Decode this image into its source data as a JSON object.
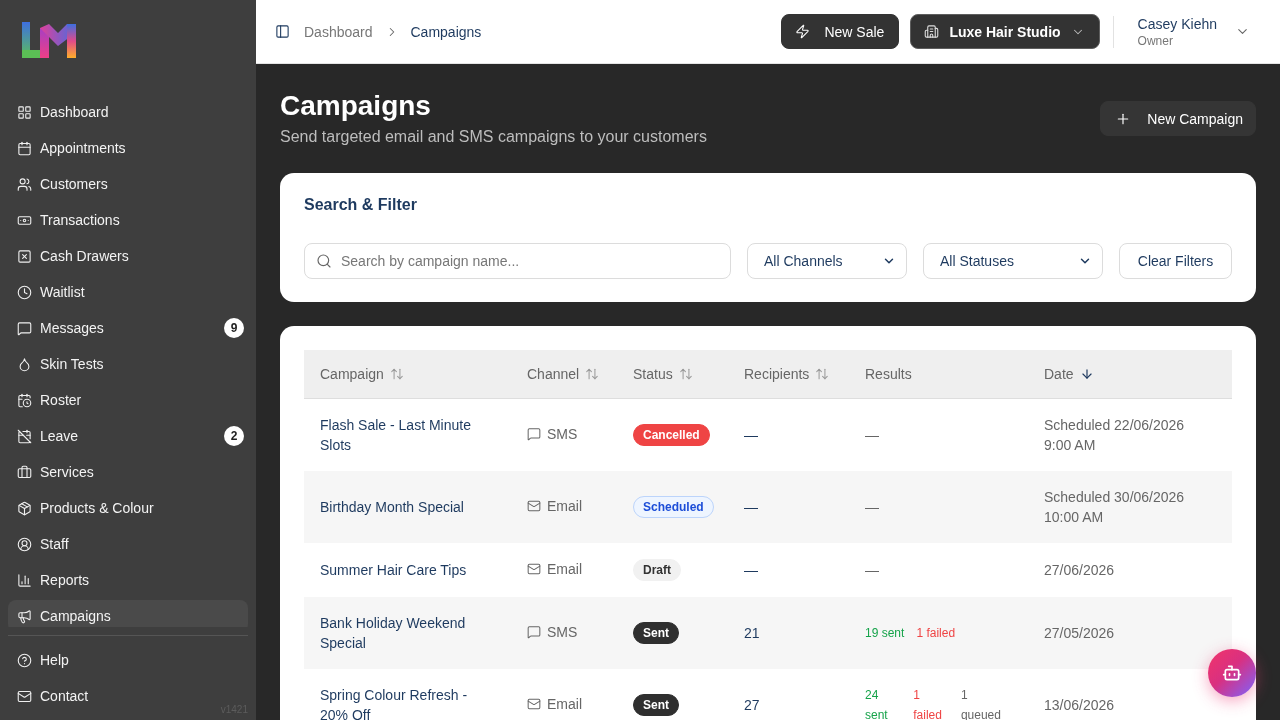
{
  "sidebar": {
    "nav_items": [
      {
        "label": "Dashboard",
        "selected": false
      },
      {
        "label": "Appointments",
        "selected": false
      },
      {
        "label": "Customers",
        "selected": false
      },
      {
        "label": "Transactions",
        "selected": false
      },
      {
        "label": "Cash Drawers",
        "selected": false
      },
      {
        "label": "Waitlist",
        "selected": false
      },
      {
        "label": "Messages",
        "selected": false,
        "badge": "9"
      },
      {
        "label": "Skin Tests",
        "selected": false
      },
      {
        "label": "Roster",
        "selected": false
      },
      {
        "label": "Leave",
        "selected": false,
        "badge": "2"
      },
      {
        "label": "Services",
        "selected": false
      },
      {
        "label": "Products & Colour",
        "selected": false
      },
      {
        "label": "Staff",
        "selected": false
      },
      {
        "label": "Reports",
        "selected": false
      },
      {
        "label": "Campaigns",
        "selected": true
      }
    ],
    "footer_items": [
      {
        "label": "Help",
        "selected": false
      },
      {
        "label": "Contact",
        "selected": false
      }
    ],
    "version": "v1421"
  },
  "topbar": {
    "breadcrumbs": [
      {
        "label": "Dashboard",
        "current": false
      },
      {
        "label": "Campaigns",
        "current": true
      }
    ],
    "new_sale_button": "New Sale",
    "location_button": "Luxe Hair Studio",
    "user": {
      "name": "Casey Kiehn",
      "role": "Owner"
    }
  },
  "page_header": {
    "title": "Campaigns",
    "subtitle": "Send targeted email and SMS campaigns to your customers",
    "new_campaign_button": "New Campaign"
  },
  "filters": {
    "title": "Search & Filter",
    "search": {
      "placeholder": "Search by campaign name..."
    },
    "channel_select": {
      "value": "All Channels"
    },
    "status_select": {
      "value": "All Statuses"
    },
    "clear_button": "Clear Filters"
  },
  "table": {
    "columns": [
      {
        "label": "Campaign",
        "kind": "sortable"
      },
      {
        "label": "Channel",
        "kind": "sortable"
      },
      {
        "label": "Status",
        "kind": "sortable"
      },
      {
        "label": "Recipients",
        "kind": "sortable"
      },
      {
        "label": "Results",
        "kind": "plain"
      },
      {
        "label": "Date",
        "kind": "sorted"
      }
    ],
    "rows": [
      {
        "campaign": "Flash Sale - Last Minute Slots",
        "channel": {
          "label": "SMS",
          "kind": "sms"
        },
        "status": {
          "label": "Cancelled",
          "kind": "cancelled"
        },
        "recipients": "—",
        "results": [
          {
            "text": "—",
            "kind": "none"
          }
        ],
        "date": "Scheduled 22/06/2026 9:00 AM"
      },
      {
        "campaign": "Birthday Month Special",
        "channel": {
          "label": "Email",
          "kind": "email"
        },
        "status": {
          "label": "Scheduled",
          "kind": "scheduled"
        },
        "recipients": "—",
        "results": [
          {
            "text": "—",
            "kind": "none"
          }
        ],
        "date": "Scheduled 30/06/2026 10:00 AM"
      },
      {
        "campaign": "Summer Hair Care Tips",
        "channel": {
          "label": "Email",
          "kind": "email"
        },
        "status": {
          "label": "Draft",
          "kind": "draft"
        },
        "recipients": "—",
        "results": [
          {
            "text": "—",
            "kind": "none"
          }
        ],
        "date": "27/06/2026"
      },
      {
        "campaign": "Bank Holiday Weekend Special",
        "channel": {
          "label": "SMS",
          "kind": "sms"
        },
        "status": {
          "label": "Sent",
          "kind": "sent"
        },
        "recipients": "21",
        "results": [
          {
            "text": "19 sent",
            "kind": "sent"
          },
          {
            "text": "1 failed",
            "kind": "failed"
          }
        ],
        "date": "27/05/2026"
      },
      {
        "campaign": "Spring Colour Refresh - 20% Off",
        "channel": {
          "label": "Email",
          "kind": "email"
        },
        "status": {
          "label": "Sent",
          "kind": "sent"
        },
        "recipients": "27",
        "results": [
          {
            "text": "24 sent",
            "kind": "sent"
          },
          {
            "text": "1 failed",
            "kind": "failed"
          },
          {
            "text": "1 queued",
            "kind": "queued"
          }
        ],
        "date": "13/06/2026"
      }
    ]
  }
}
